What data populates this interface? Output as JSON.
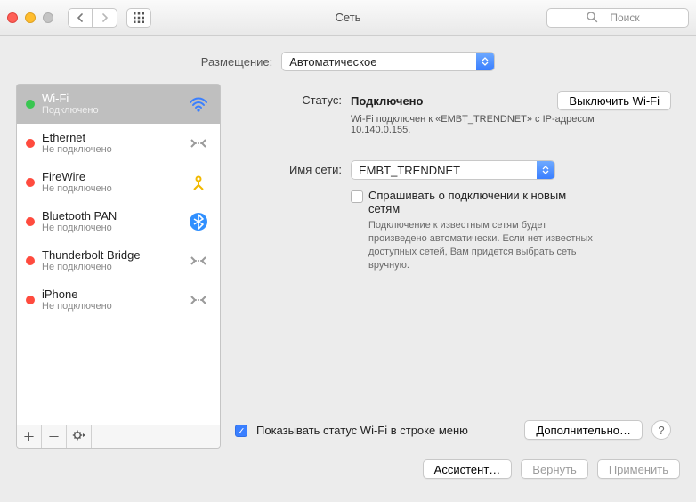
{
  "window": {
    "title": "Сеть",
    "search_placeholder": "Поиск"
  },
  "location": {
    "label": "Размещение:",
    "value": "Автоматическое"
  },
  "sidebar": {
    "items": [
      {
        "name": "Wi-Fi",
        "sub": "Подключено",
        "status": "green",
        "icon": "wifi",
        "selected": true
      },
      {
        "name": "Ethernet",
        "sub": "Не подключено",
        "status": "red",
        "icon": "ethernet"
      },
      {
        "name": "FireWire",
        "sub": "Не подключено",
        "status": "red",
        "icon": "firewire"
      },
      {
        "name": "Bluetooth PAN",
        "sub": "Не подключено",
        "status": "red",
        "icon": "bluetooth"
      },
      {
        "name": "Thunderbolt Bridge",
        "sub": "Не подключено",
        "status": "red",
        "icon": "thunderbolt"
      },
      {
        "name": "iPhone",
        "sub": "Не подключено",
        "status": "red",
        "icon": "iphone"
      }
    ]
  },
  "detail": {
    "status_label": "Статус:",
    "status_value": "Подключено",
    "turnoff_button": "Выключить Wi-Fi",
    "status_sub": "Wi-Fi подключен к «EMBT_TRENDNET» с IP-адресом 10.140.0.155.",
    "network_label": "Имя сети:",
    "network_value": "EMBT_TRENDNET",
    "ask_join_label": "Спрашивать о подключении к новым сетям",
    "ask_join_hint": "Подключение к известным сетям будет произведено автоматически. Если нет известных доступных сетей, Вам придется выбрать сеть вручную.",
    "ask_join_checked": false,
    "show_status_label": "Показывать статус Wi-Fi в строке меню",
    "show_status_checked": true,
    "advanced_button": "Дополнительно…"
  },
  "footer": {
    "assist": "Ассистент…",
    "revert": "Вернуть",
    "apply": "Применить"
  }
}
